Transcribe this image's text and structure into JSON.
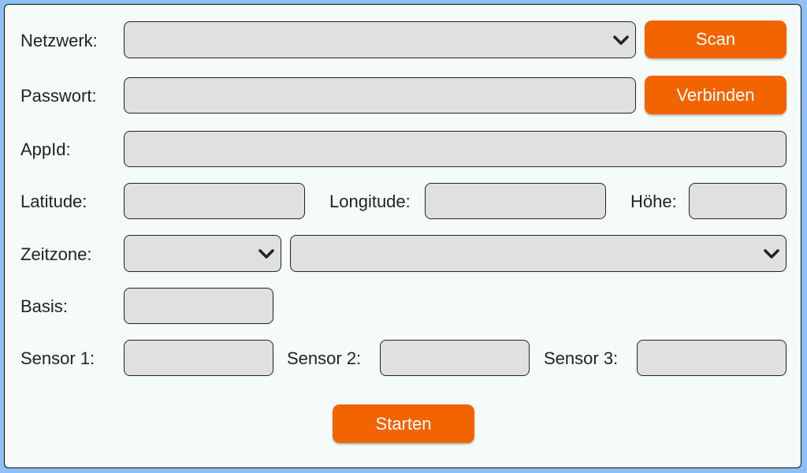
{
  "form": {
    "network_label": "Netzwerk:",
    "network_value": "",
    "scan_button": "Scan",
    "password_label": "Passwort:",
    "password_value": "",
    "connect_button": "Verbinden",
    "appid_label": "AppId:",
    "appid_value": "",
    "latitude_label": "Latitude:",
    "latitude_value": "",
    "longitude_label": "Longitude:",
    "longitude_value": "",
    "height_label": "Höhe:",
    "height_value": "",
    "timezone_label": "Zeitzone:",
    "timezone_region_value": "",
    "timezone_city_value": "",
    "basis_label": "Basis:",
    "basis_value": "",
    "sensor1_label": "Sensor 1:",
    "sensor1_value": "",
    "sensor2_label": "Sensor 2:",
    "sensor2_value": "",
    "sensor3_label": "Sensor 3:",
    "sensor3_value": "",
    "start_button": "Starten"
  },
  "colors": {
    "accent": "#f26400",
    "background": "#8fbff7",
    "panel": "#f5fbf8",
    "field": "#e0e0e0"
  }
}
